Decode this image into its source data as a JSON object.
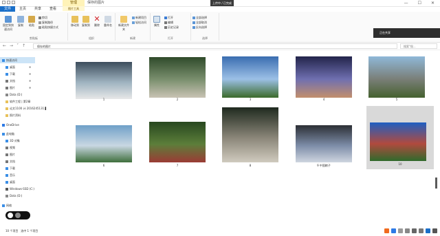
{
  "titlebar": {
    "context_tab": "管理",
    "context_label": "图片工具",
    "title": "保存的图片",
    "notification": "上传中 / 已完成"
  },
  "tabs": [
    "文件",
    "主页",
    "共享",
    "查看"
  ],
  "ribbon": {
    "groups": {
      "clipboard": "剪贴板",
      "organize": "组织",
      "new": "新建",
      "open": "打开",
      "select": "选择"
    },
    "buttons": {
      "pin": "固定到快速访问",
      "copy": "复制",
      "paste": "粘贴",
      "cut": "剪切",
      "copy_path": "复制路径",
      "paste_shortcut": "粘贴快捷方式",
      "move_to": "移动到",
      "copy_to": "复制到",
      "delete": "删除",
      "rename": "重命名",
      "new_folder": "新建文件夹",
      "new_item": "新建项目",
      "easy_access": "轻松访问",
      "properties": "属性",
      "open": "打开",
      "edit": "编辑",
      "history": "历史记录",
      "select_all": "全部选择",
      "select_none": "全部取消",
      "invert_selection": "反向选择"
    }
  },
  "address": {
    "path": "保存的图片",
    "search_placeholder": "搜索\"保..."
  },
  "sidebar": {
    "items": [
      {
        "label": "快速访问",
        "selected": true
      },
      {
        "label": "桌面"
      },
      {
        "label": "下载"
      },
      {
        "label": "文档"
      },
      {
        "label": "图片"
      },
      {
        "label": "Data (D:)"
      },
      {
        "label": "软件工程 | 第2章"
      },
      {
        "label": "论文1100 计 2016245131 ▌"
      },
      {
        "label": "照片资料"
      },
      {
        "label": "OneDrive"
      },
      {
        "label": "此电脑"
      },
      {
        "label": "3D 对象"
      },
      {
        "label": "视频"
      },
      {
        "label": "图片"
      },
      {
        "label": "文档"
      },
      {
        "label": "下载"
      },
      {
        "label": "音乐"
      },
      {
        "label": "桌面"
      },
      {
        "label": "Windows-SSD (C:)"
      },
      {
        "label": "Data (D:)"
      },
      {
        "label": "网络"
      }
    ]
  },
  "files": [
    {
      "caption": "1",
      "colors": [
        "#3c4d5c",
        "#9fb3c0",
        "#e8e8e8"
      ]
    },
    {
      "caption": "2",
      "colors": [
        "#2f4a2a",
        "#7a8f6e",
        "#c9c3b4"
      ]
    },
    {
      "caption": "3",
      "colors": [
        "#3a6db0",
        "#9cc0e6",
        "#3b6a2a"
      ]
    },
    {
      "caption": "4",
      "colors": [
        "#22244a",
        "#6f6fb0",
        "#c38f6c"
      ]
    },
    {
      "caption": "5",
      "colors": [
        "#8fb8d8",
        "#7a7f78",
        "#45612f"
      ]
    },
    {
      "caption": "6",
      "colors": [
        "#6fa0c8",
        "#c9d7e2",
        "#3f6f3c"
      ]
    },
    {
      "caption": "7",
      "colors": [
        "#27471f",
        "#5c7e3a",
        "#9b3b35"
      ]
    },
    {
      "caption": "8",
      "colors": [
        "#1f2a1f",
        "#8a8578",
        "#d0cbbf"
      ]
    },
    {
      "caption": "9 中国粮子",
      "colors": [
        "#2c2f35",
        "#7d8da8",
        "#cfd6e0"
      ]
    },
    {
      "caption": "10",
      "colors": [
        "#1f5fc2",
        "#b14a3e",
        "#2f6a2c"
      ],
      "selected": true
    }
  ],
  "status": {
    "count_text": "10 个项目",
    "selected_text": "选中 1 个项目"
  },
  "remote_notice": "正在共享"
}
